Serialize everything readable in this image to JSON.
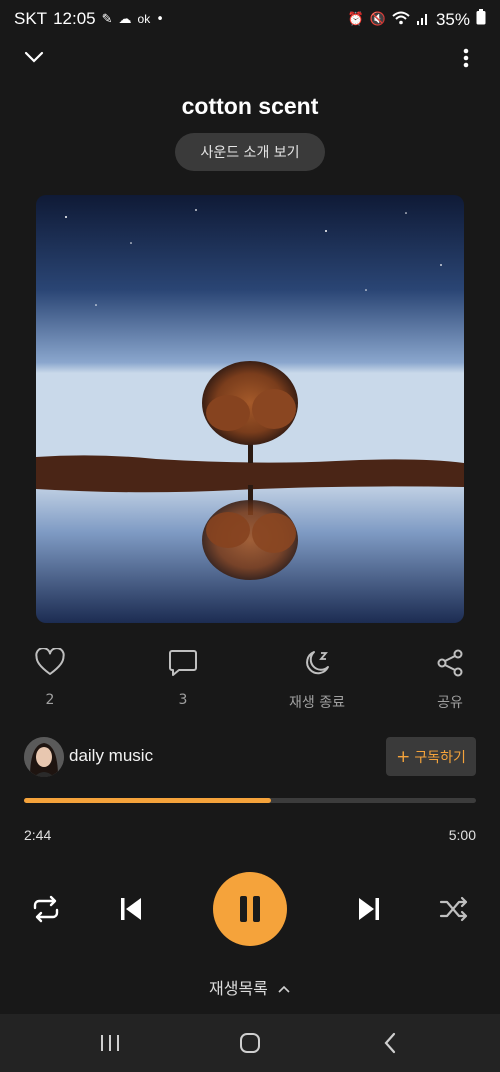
{
  "status_bar": {
    "carrier": "SKT",
    "time": "12:05",
    "notif_text": "ok",
    "battery": "35%"
  },
  "player": {
    "title": "cotton scent",
    "intro_button": "사운드 소개 보기"
  },
  "actions": {
    "like_count": "2",
    "comment_count": "3",
    "sleep_label": "재생 종료",
    "share_label": "공유"
  },
  "artist": {
    "name": "daily music",
    "subscribe_label": "구독하기",
    "subscribe_plus": "+"
  },
  "progress": {
    "elapsed": "2:44",
    "total": "5:00",
    "fraction": 0.547
  },
  "playlist_label": "재생목록",
  "colors": {
    "accent": "#f5a33b",
    "background": "#181818"
  }
}
